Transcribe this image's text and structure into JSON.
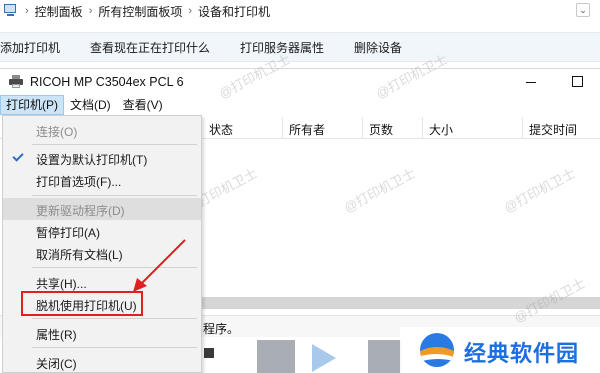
{
  "breadcrumb": [
    "控制面板",
    "所有控制面板项",
    "设备和打印机"
  ],
  "commandbar": [
    "添加打印机",
    "查看现在正在打印什么",
    "打印服务器属性",
    "删除设备"
  ],
  "window": {
    "title": "RICOH MP C3504ex PCL 6"
  },
  "menubar": [
    "打印机(P)",
    "文档(D)",
    "查看(V)"
  ],
  "columns": [
    "状态",
    "所有者",
    "页数",
    "大小",
    "提交时间"
  ],
  "status_text": "程序。",
  "dropdown": {
    "items": [
      {
        "label": "连接(O)",
        "disabled": true
      },
      {
        "label": "设置为默认打印机(T)",
        "checked": true
      },
      {
        "label": "打印首选项(F)..."
      },
      {
        "label": "更新驱动程序(D)",
        "disabled": true
      },
      {
        "label": "暂停打印(A)"
      },
      {
        "label": "取消所有文档(L)"
      },
      {
        "label": "共享(H)..."
      },
      {
        "label": "脱机使用打印机(U)"
      },
      {
        "label": "属性(R)"
      },
      {
        "label": "关闭(C)"
      }
    ]
  },
  "watermark": "@打印机卫士",
  "logo": {
    "text": "经典软件园"
  },
  "colors": {
    "highlight_box": "#e02020",
    "arrow": "#e02020",
    "menu_open": "#cce4f7",
    "logo_blue": "#1d6fe0",
    "logo_orange": "#f39a24"
  }
}
